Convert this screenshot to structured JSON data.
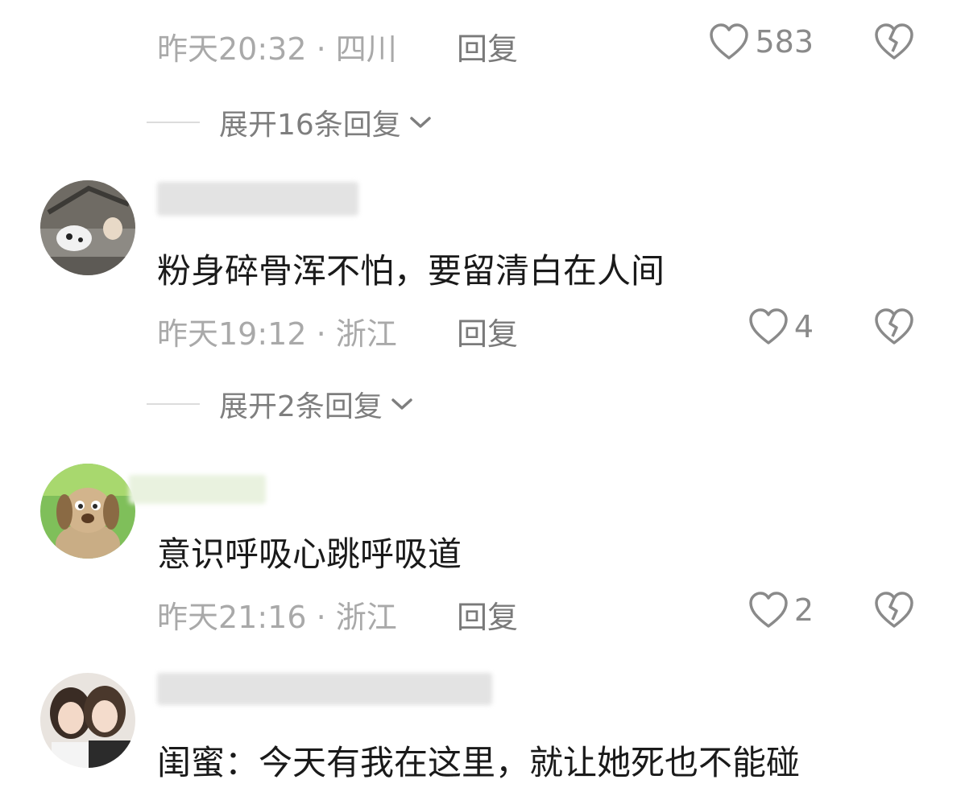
{
  "comments": [
    {
      "meta": "昨天20:32 · 四川",
      "reply_label": "回复",
      "likes": "583",
      "expand_label": "展开16条回复"
    },
    {
      "text": "粉身碎骨浑不怕，要留清白在人间",
      "meta": "昨天19:12 · 浙江",
      "reply_label": "回复",
      "likes": "4",
      "expand_label": "展开2条回复"
    },
    {
      "text": "意识呼吸心跳呼吸道",
      "meta": "昨天21:16 · 浙江",
      "reply_label": "回复",
      "likes": "2"
    },
    {
      "text": "闺蜜：今天有我在这里，就让她死也不能碰"
    }
  ],
  "icons": {
    "like": "heart-outline-icon",
    "dislike": "broken-heart-icon",
    "expand": "chevron-down-icon"
  },
  "colors": {
    "text": "#1a1a1a",
    "meta": "#a9a9a9",
    "icon": "#8a8a8a"
  }
}
